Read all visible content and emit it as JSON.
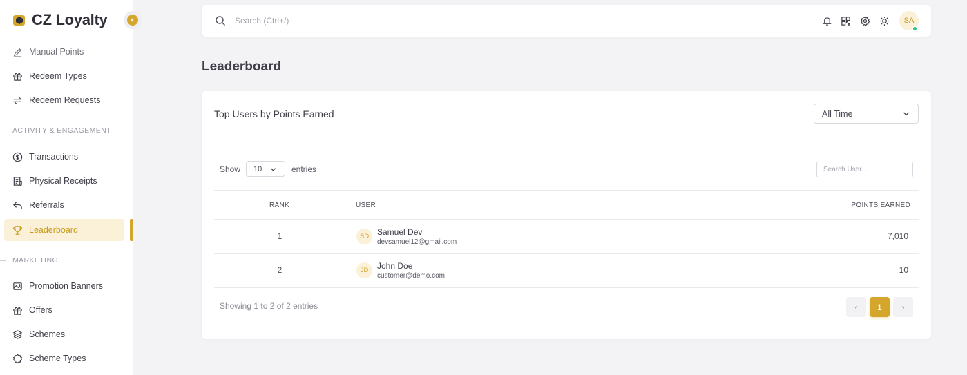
{
  "brand": {
    "name": "CZ Loyalty"
  },
  "sidebar": {
    "items_top": [
      {
        "label": "Manual Points",
        "icon": "pencil-icon"
      },
      {
        "label": "Redeem Types",
        "icon": "gift-icon"
      },
      {
        "label": "Redeem Requests",
        "icon": "arrows-swap-icon"
      }
    ],
    "section_activity": "Activity & Engagement",
    "items_activity": [
      {
        "label": "Transactions",
        "icon": "dollar-circle-icon"
      },
      {
        "label": "Physical Receipts",
        "icon": "receipt-icon"
      },
      {
        "label": "Referrals",
        "icon": "reply-arrow-icon"
      },
      {
        "label": "Leaderboard",
        "icon": "trophy-icon",
        "active": true
      }
    ],
    "section_marketing": "Marketing",
    "items_marketing": [
      {
        "label": "Promotion Banners",
        "icon": "image-icon"
      },
      {
        "label": "Offers",
        "icon": "gift-icon"
      },
      {
        "label": "Schemes",
        "icon": "layers-icon"
      },
      {
        "label": "Scheme Types",
        "icon": "badge-icon"
      }
    ]
  },
  "topbar": {
    "search_placeholder": "Search (Ctrl+/)",
    "icons": [
      "bell-icon",
      "grid-icon",
      "gear-icon",
      "sun-icon"
    ],
    "avatar_initials": "SA"
  },
  "page": {
    "title": "Leaderboard"
  },
  "card": {
    "title": "Top Users by Points Earned",
    "period_value": "All Time",
    "show_label": "Show",
    "entries_value": "10",
    "entries_label": "entries",
    "user_search_placeholder": "Search User...",
    "columns": {
      "rank": "Rank",
      "user": "User",
      "points": "Points Earned"
    },
    "rows": [
      {
        "rank": "1",
        "initials": "SD",
        "name": "Samuel Dev",
        "email": "devsamuel12@gmail.com",
        "points": "7,010"
      },
      {
        "rank": "2",
        "initials": "JD",
        "name": "John Doe",
        "email": "customer@demo.com",
        "points": "10"
      }
    ],
    "showing_text": "Showing 1 to 2 of 2 entries",
    "pagination": {
      "prev": "‹",
      "current": "1",
      "next": "›"
    }
  },
  "colors": {
    "accent": "#d4a72c",
    "accent_light": "#fbf1d8",
    "background": "#f3f3f6"
  }
}
